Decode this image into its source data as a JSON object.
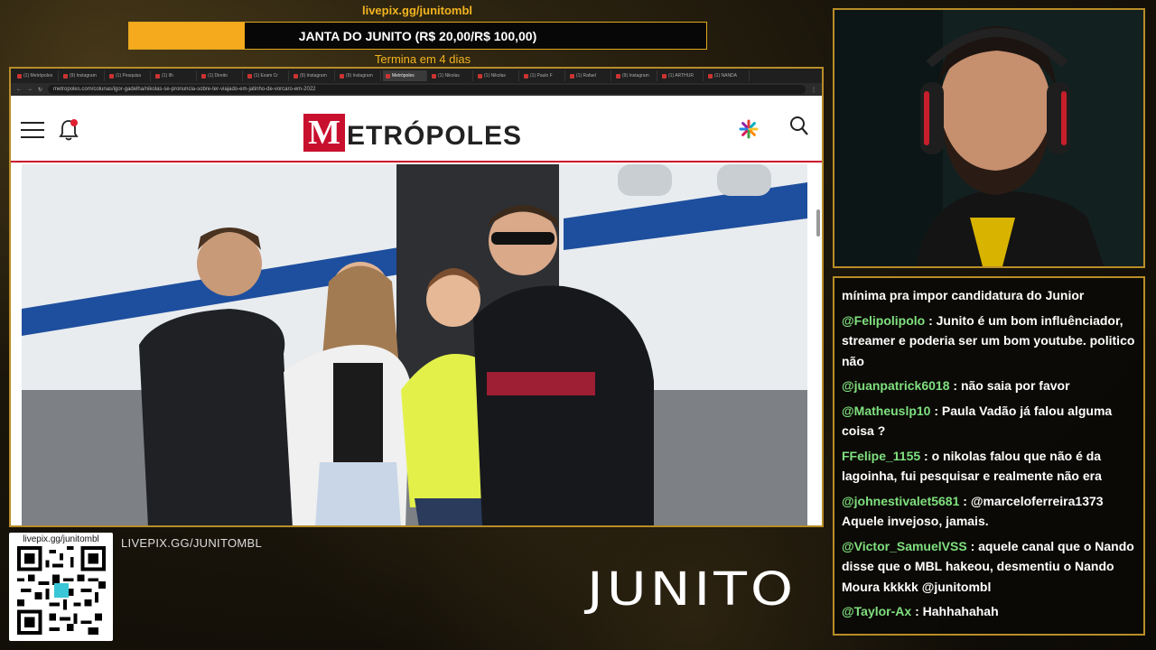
{
  "goal": {
    "url": "livepix.gg/junitombl",
    "title": "JANTA DO JUNITO (R$ 20,00/R$ 100,00)",
    "progress": 0.2,
    "ends": "Termina em 4 dias"
  },
  "browser": {
    "tabs": [
      "(1) Metrópoles",
      "(9) Instagram",
      "(1) Pesquisa",
      "(1) Ilh",
      "(1) Direito",
      "(1) Exam Cr",
      "(9) Instagram",
      "(9) Instagram",
      "Metrópoles",
      "(1) Nikolas",
      "(1) Nikolas",
      "(1) Paulo F",
      "(1) Rafael",
      "(9) Instagram",
      "(1) ARTHUR",
      "(1) NANDA"
    ],
    "url": "metropoles.com/colunas/igor-gadelha/nikolas-se-pronuncia-sobre-ter-viajado-em-jatinho-de-vorcaro-em-2022"
  },
  "site": {
    "logo_m": "M",
    "logo_rest": "ETRÓPOLES"
  },
  "overlay": {
    "qr_label": "livepix.gg/junitombl",
    "livepix_link": "LIVEPIX.GG/JUNITOMBL",
    "brand": "JUNITO"
  },
  "chat": [
    {
      "user": "",
      "text": "mínima pra impor candidatura do Junior"
    },
    {
      "user": "@Felipolipolo",
      "text": " : Junito é um bom influênciador, streamer e poderia ser um bom youtube. politico não"
    },
    {
      "user": "@juanpatrick6018",
      "text": " : não saia por favor"
    },
    {
      "user": "@Matheuslp10",
      "text": " : Paula Vadão já falou alguma coisa ?"
    },
    {
      "user": "FFelipe_1155",
      "text": " : o nikolas falou que não é da lagoinha, fui pesquisar e realmente não era"
    },
    {
      "user": "@johnestivalet5681",
      "text": " : @marceloferreira1373 Aquele invejoso, jamais."
    },
    {
      "user": "@Victor_SamuelVSS",
      "text": " : aquele canal que o Nando disse que o MBL hakeou, desmentiu o Nando Moura kkkkk @junitombl"
    },
    {
      "user": "@Taylor-Ax",
      "text": " : Hahhahahah"
    }
  ]
}
